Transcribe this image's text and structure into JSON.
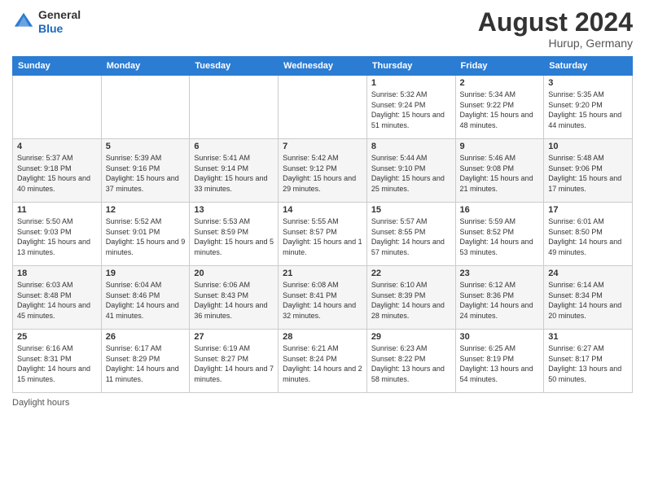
{
  "logo": {
    "general": "General",
    "blue": "Blue"
  },
  "title": {
    "month_year": "August 2024",
    "location": "Hurup, Germany"
  },
  "days_of_week": [
    "Sunday",
    "Monday",
    "Tuesday",
    "Wednesday",
    "Thursday",
    "Friday",
    "Saturday"
  ],
  "weeks": [
    [
      {
        "day": "",
        "info": ""
      },
      {
        "day": "",
        "info": ""
      },
      {
        "day": "",
        "info": ""
      },
      {
        "day": "",
        "info": ""
      },
      {
        "day": "1",
        "info": "Sunrise: 5:32 AM\nSunset: 9:24 PM\nDaylight: 15 hours and 51 minutes."
      },
      {
        "day": "2",
        "info": "Sunrise: 5:34 AM\nSunset: 9:22 PM\nDaylight: 15 hours and 48 minutes."
      },
      {
        "day": "3",
        "info": "Sunrise: 5:35 AM\nSunset: 9:20 PM\nDaylight: 15 hours and 44 minutes."
      }
    ],
    [
      {
        "day": "4",
        "info": "Sunrise: 5:37 AM\nSunset: 9:18 PM\nDaylight: 15 hours and 40 minutes."
      },
      {
        "day": "5",
        "info": "Sunrise: 5:39 AM\nSunset: 9:16 PM\nDaylight: 15 hours and 37 minutes."
      },
      {
        "day": "6",
        "info": "Sunrise: 5:41 AM\nSunset: 9:14 PM\nDaylight: 15 hours and 33 minutes."
      },
      {
        "day": "7",
        "info": "Sunrise: 5:42 AM\nSunset: 9:12 PM\nDaylight: 15 hours and 29 minutes."
      },
      {
        "day": "8",
        "info": "Sunrise: 5:44 AM\nSunset: 9:10 PM\nDaylight: 15 hours and 25 minutes."
      },
      {
        "day": "9",
        "info": "Sunrise: 5:46 AM\nSunset: 9:08 PM\nDaylight: 15 hours and 21 minutes."
      },
      {
        "day": "10",
        "info": "Sunrise: 5:48 AM\nSunset: 9:06 PM\nDaylight: 15 hours and 17 minutes."
      }
    ],
    [
      {
        "day": "11",
        "info": "Sunrise: 5:50 AM\nSunset: 9:03 PM\nDaylight: 15 hours and 13 minutes."
      },
      {
        "day": "12",
        "info": "Sunrise: 5:52 AM\nSunset: 9:01 PM\nDaylight: 15 hours and 9 minutes."
      },
      {
        "day": "13",
        "info": "Sunrise: 5:53 AM\nSunset: 8:59 PM\nDaylight: 15 hours and 5 minutes."
      },
      {
        "day": "14",
        "info": "Sunrise: 5:55 AM\nSunset: 8:57 PM\nDaylight: 15 hours and 1 minute."
      },
      {
        "day": "15",
        "info": "Sunrise: 5:57 AM\nSunset: 8:55 PM\nDaylight: 14 hours and 57 minutes."
      },
      {
        "day": "16",
        "info": "Sunrise: 5:59 AM\nSunset: 8:52 PM\nDaylight: 14 hours and 53 minutes."
      },
      {
        "day": "17",
        "info": "Sunrise: 6:01 AM\nSunset: 8:50 PM\nDaylight: 14 hours and 49 minutes."
      }
    ],
    [
      {
        "day": "18",
        "info": "Sunrise: 6:03 AM\nSunset: 8:48 PM\nDaylight: 14 hours and 45 minutes."
      },
      {
        "day": "19",
        "info": "Sunrise: 6:04 AM\nSunset: 8:46 PM\nDaylight: 14 hours and 41 minutes."
      },
      {
        "day": "20",
        "info": "Sunrise: 6:06 AM\nSunset: 8:43 PM\nDaylight: 14 hours and 36 minutes."
      },
      {
        "day": "21",
        "info": "Sunrise: 6:08 AM\nSunset: 8:41 PM\nDaylight: 14 hours and 32 minutes."
      },
      {
        "day": "22",
        "info": "Sunrise: 6:10 AM\nSunset: 8:39 PM\nDaylight: 14 hours and 28 minutes."
      },
      {
        "day": "23",
        "info": "Sunrise: 6:12 AM\nSunset: 8:36 PM\nDaylight: 14 hours and 24 minutes."
      },
      {
        "day": "24",
        "info": "Sunrise: 6:14 AM\nSunset: 8:34 PM\nDaylight: 14 hours and 20 minutes."
      }
    ],
    [
      {
        "day": "25",
        "info": "Sunrise: 6:16 AM\nSunset: 8:31 PM\nDaylight: 14 hours and 15 minutes."
      },
      {
        "day": "26",
        "info": "Sunrise: 6:17 AM\nSunset: 8:29 PM\nDaylight: 14 hours and 11 minutes."
      },
      {
        "day": "27",
        "info": "Sunrise: 6:19 AM\nSunset: 8:27 PM\nDaylight: 14 hours and 7 minutes."
      },
      {
        "day": "28",
        "info": "Sunrise: 6:21 AM\nSunset: 8:24 PM\nDaylight: 14 hours and 2 minutes."
      },
      {
        "day": "29",
        "info": "Sunrise: 6:23 AM\nSunset: 8:22 PM\nDaylight: 13 hours and 58 minutes."
      },
      {
        "day": "30",
        "info": "Sunrise: 6:25 AM\nSunset: 8:19 PM\nDaylight: 13 hours and 54 minutes."
      },
      {
        "day": "31",
        "info": "Sunrise: 6:27 AM\nSunset: 8:17 PM\nDaylight: 13 hours and 50 minutes."
      }
    ]
  ],
  "footer": {
    "daylight_label": "Daylight hours"
  }
}
